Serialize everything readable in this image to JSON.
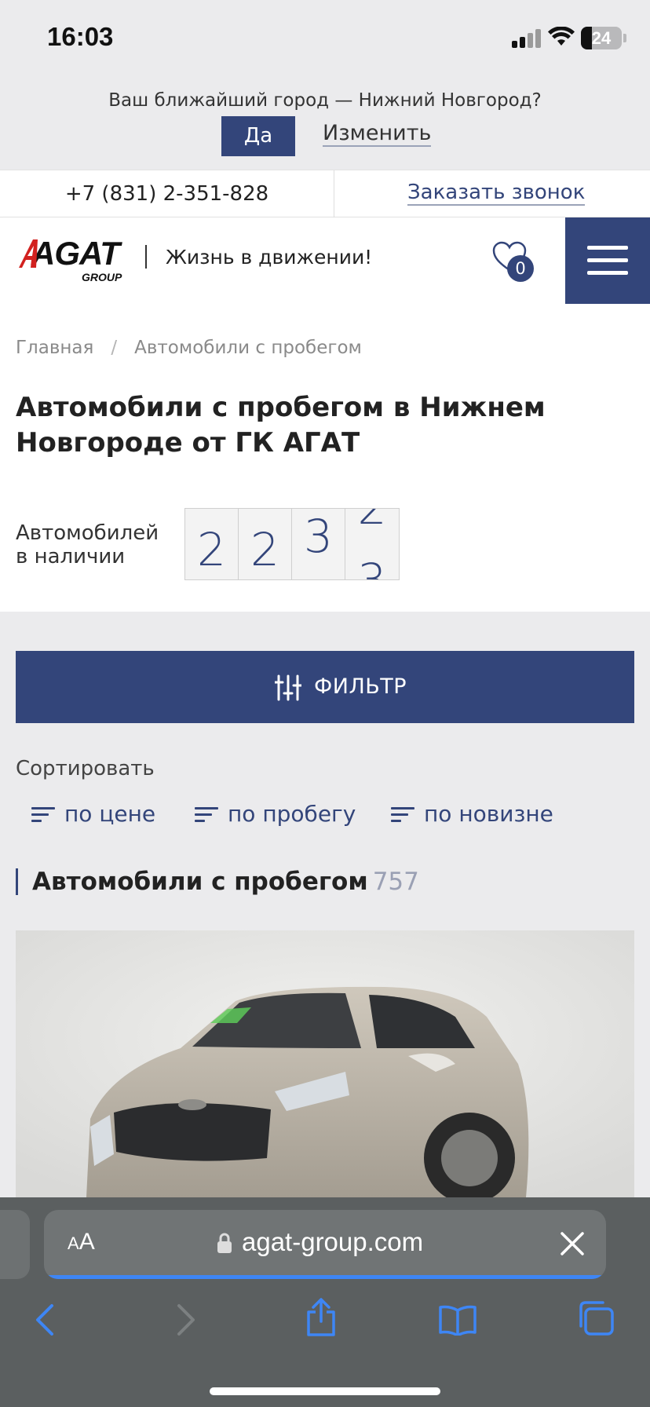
{
  "status_bar": {
    "time": "16:03",
    "battery": "24"
  },
  "city_bar": {
    "question": "Ваш ближайший город — Нижний Новгород?",
    "yes_label": "Да",
    "change_label": "Изменить"
  },
  "contact_bar": {
    "phone": "+7 (831) 2-351-828",
    "callback_label": "Заказать звонок"
  },
  "header": {
    "logo_text": "AGAT",
    "logo_sub": "GROUP",
    "slogan": "Жизнь в движении!",
    "favorites_count": "0",
    "icons": [
      "heart-icon",
      "menu-icon"
    ]
  },
  "breadcrumb": {
    "home": "Главная",
    "separator": "/",
    "current": "Автомобили с пробегом"
  },
  "page": {
    "title": "Автомобили с пробегом в Нижнем Новгороде от ГК АГАТ",
    "count_label": "Автомобилей в наличии",
    "counter_digits": [
      "2",
      "2",
      "3"
    ],
    "counter_rolling": {
      "top": "2",
      "bottom": "3"
    }
  },
  "filter": {
    "label": "ФИЛЬТР"
  },
  "sort": {
    "title": "Сортировать",
    "options": [
      "по цене",
      "по пробегу",
      "по новизне"
    ]
  },
  "listing": {
    "heading": "Автомобили с пробегом",
    "count": "757"
  },
  "safari": {
    "aa_small": "A",
    "aa_large": "A",
    "url": "agat-group.com",
    "accent_color": "#3e86f5"
  },
  "colors": {
    "brand": "#33457a",
    "logo_red": "#d2211f"
  }
}
